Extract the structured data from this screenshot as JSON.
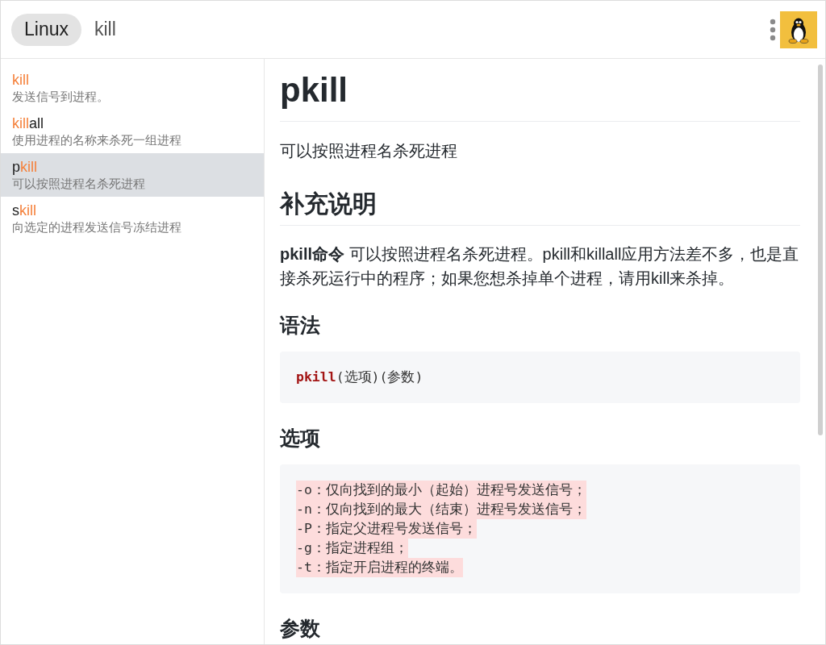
{
  "header": {
    "category": "Linux",
    "search": {
      "value": "kill"
    }
  },
  "sidebar": {
    "items": [
      {
        "title": [
          {
            "text": "kill",
            "match": true
          }
        ],
        "description": "发送信号到进程。",
        "selected": false
      },
      {
        "title": [
          {
            "text": "kill",
            "match": true
          },
          {
            "text": "all",
            "match": false
          }
        ],
        "description": "使用进程的名称来杀死一组进程",
        "selected": false
      },
      {
        "title": [
          {
            "text": "p",
            "match": false
          },
          {
            "text": "kill",
            "match": true
          }
        ],
        "description": "可以按照进程名杀死进程",
        "selected": true
      },
      {
        "title": [
          {
            "text": "s",
            "match": false
          },
          {
            "text": "kill",
            "match": true
          }
        ],
        "description": "向选定的进程发送信号冻结进程",
        "selected": false
      }
    ]
  },
  "article": {
    "title": "pkill",
    "summary": "可以按照进程名杀死进程",
    "sections": [
      {
        "heading": "补充说明",
        "kind": "major",
        "blocks": [
          {
            "kind": "paragraph",
            "text": "**pkill命令** 可以按照进程名杀死进程。pkill和killall应用方法差不多，也是直接杀死运行中的程序；如果您想杀掉单个进程，请用kill来杀掉。"
          }
        ]
      },
      {
        "heading": "语法",
        "kind": "minor",
        "blocks": [
          {
            "kind": "code",
            "lines": [
              {
                "text": "**pkill**(选项)(参数)",
                "highlighted": false
              }
            ]
          }
        ]
      },
      {
        "heading": "选项",
        "kind": "minor",
        "blocks": [
          {
            "kind": "code",
            "lines": [
              {
                "text": "-o：仅向找到的最小（起始）进程号发送信号；",
                "highlighted": true
              },
              {
                "text": "-n：仅向找到的最大（结束）进程号发送信号；",
                "highlighted": true
              },
              {
                "text": "-P：指定父进程号发送信号；",
                "highlighted": true
              },
              {
                "text": "-g：指定进程组；",
                "highlighted": true
              },
              {
                "text": "-t：指定开启进程的终端。",
                "highlighted": true
              }
            ]
          }
        ]
      },
      {
        "heading": "参数",
        "kind": "minor"
      }
    ]
  }
}
